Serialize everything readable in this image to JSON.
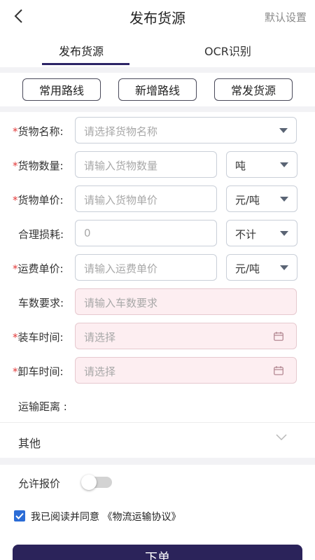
{
  "header": {
    "title": "发布货源",
    "right_action": "默认设置"
  },
  "tabs": [
    {
      "label": "发布货源",
      "active": true
    },
    {
      "label": "OCR识别",
      "active": false
    }
  ],
  "quick_buttons": [
    "常用路线",
    "新增路线",
    "常发货源"
  ],
  "form": {
    "cargo_name": {
      "label": "货物名称:",
      "placeholder": "请选择货物名称",
      "required": true
    },
    "cargo_quantity": {
      "label": "货物数量:",
      "placeholder": "请输入货物数量",
      "required": true,
      "unit": "吨"
    },
    "cargo_price": {
      "label": "货物单价:",
      "placeholder": "请输入货物单价",
      "required": true,
      "unit": "元/吨"
    },
    "loss": {
      "label": "合理损耗:",
      "placeholder": "0",
      "required": false,
      "unit": "不计"
    },
    "freight_price": {
      "label": "运费单价:",
      "placeholder": "请输入运费单价",
      "required": true,
      "unit": "元/吨"
    },
    "truck_count": {
      "label": "车数要求:",
      "placeholder": "请输入车数要求",
      "required": false
    },
    "load_time": {
      "label": "装车时间:",
      "placeholder": "请选择",
      "required": true
    },
    "unload_time": {
      "label": "卸车时间:",
      "placeholder": "请选择",
      "required": true
    },
    "distance": {
      "label": "运输距离 :"
    }
  },
  "other": {
    "label": "其他"
  },
  "allow_quote": {
    "label": "允许报价",
    "enabled": false
  },
  "agreement": {
    "text": "我已阅读并同意",
    "link": "《物流运输协议》",
    "checked": true
  },
  "submit": {
    "label": "下单"
  },
  "colors": {
    "primary": "#2b235a",
    "required_star": "#e23b3b",
    "checkbox": "#2b6cd6",
    "highlight_field": "#fdeef1"
  }
}
